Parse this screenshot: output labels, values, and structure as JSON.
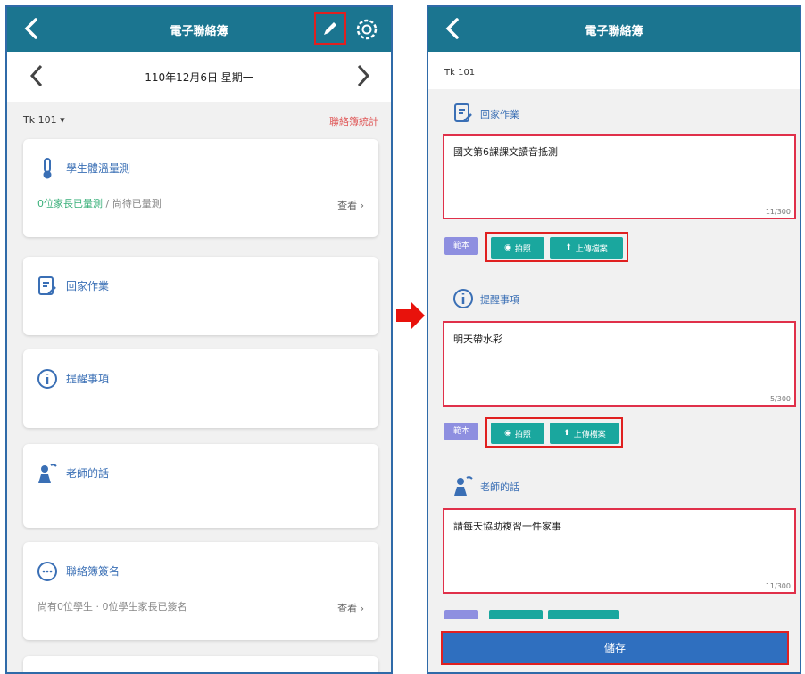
{
  "left": {
    "title": "電子聯絡簿",
    "date": "110年12月6日 星期一",
    "class_label": "Tk 101 ▾",
    "link_text": "聯絡簿統計",
    "cards": [
      {
        "title": "學生體溫量測",
        "desc_accent": "0位家長已量測",
        "desc_rest": " / 尚待已量測",
        "more": "查看"
      },
      {
        "title": "回家作業",
        "desc_accent": "",
        "desc_rest": "",
        "more": ""
      },
      {
        "title": "提醒事項",
        "desc_accent": "",
        "desc_rest": "",
        "more": ""
      },
      {
        "title": "老師的話",
        "desc_accent": "",
        "desc_rest": "",
        "more": ""
      },
      {
        "title": "聯絡簿簽名",
        "desc_accent": "",
        "desc_rest": "尚有0位學生 · 0位學生家長已簽名",
        "more": "查看"
      }
    ]
  },
  "right": {
    "title": "電子聯絡簿",
    "class_label": "Tk 101",
    "sections": [
      {
        "label": "回家作業",
        "text": "國文第6課課文讀音抵測",
        "count": "11/300"
      },
      {
        "label": "提醒事項",
        "text": "明天帶水彩",
        "count": "5/300"
      },
      {
        "label": "老師的話",
        "text": "請每天協助複習一件家事",
        "count": "11/300"
      }
    ],
    "tag_label": "範本",
    "photo_label": "拍照",
    "upload_label": "上傳檔案",
    "submit_label": "儲存"
  },
  "colors": {
    "appbar": "#1b7590",
    "highlight": "#e02020",
    "teal_button": "#1aa79e",
    "tag": "#8e8fe0",
    "submit": "#2f6fbf"
  }
}
